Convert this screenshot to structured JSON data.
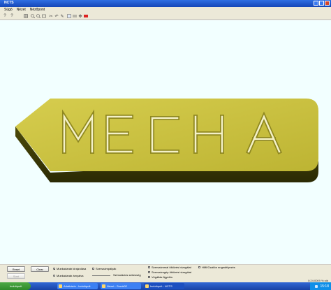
{
  "window": {
    "title": "NCTS"
  },
  "menu": [
    "Súgó",
    "Nézet",
    "Nézőpont"
  ],
  "toolbar": {
    "icons": [
      "help-icon",
      "help-icon",
      "grid-icon",
      "zoom-in-icon",
      "zoom-out-icon",
      "zoom-fit-icon",
      "scissors-icon",
      "undo-icon",
      "pen-icon",
      "view-icon",
      "layers-icon",
      "arrows-icon",
      "color-icon"
    ]
  },
  "viewport": {
    "engraved_text": "MECHA",
    "plate_color": "#c9bf3f",
    "background": "#f2ffff"
  },
  "controls": {
    "reset": "Reset",
    "start": "Start",
    "clear": "Clear",
    "radio_transparent": "Munkadarab kirajzolása",
    "radio_solid": "Munkadarab árnyalva",
    "check_simulation": "Szerszámpályák",
    "check_speed": "Szimulációs sebesség",
    "check_wire1": "Szerszámmal ütközési vizsgálat",
    "check_wire2": "Szerszámgép ütközési vizsgálat",
    "check_wire3": "Végállás figyelés",
    "check_hmi": "HMI/Csatlón engedélyezés",
    "status": "0:24:0009  % stb"
  },
  "taskbar": {
    "start_label": "Indulópult",
    "items": [
      {
        "label": "Indulópult",
        "active": false
      },
      {
        "label": "Adatbázis - Indulópult",
        "active": false
      },
      {
        "label": "Nézet - Sorok02",
        "active": false
      },
      {
        "label": "Indulópult - NCTS",
        "active": true
      }
    ],
    "clock": "15:18"
  }
}
